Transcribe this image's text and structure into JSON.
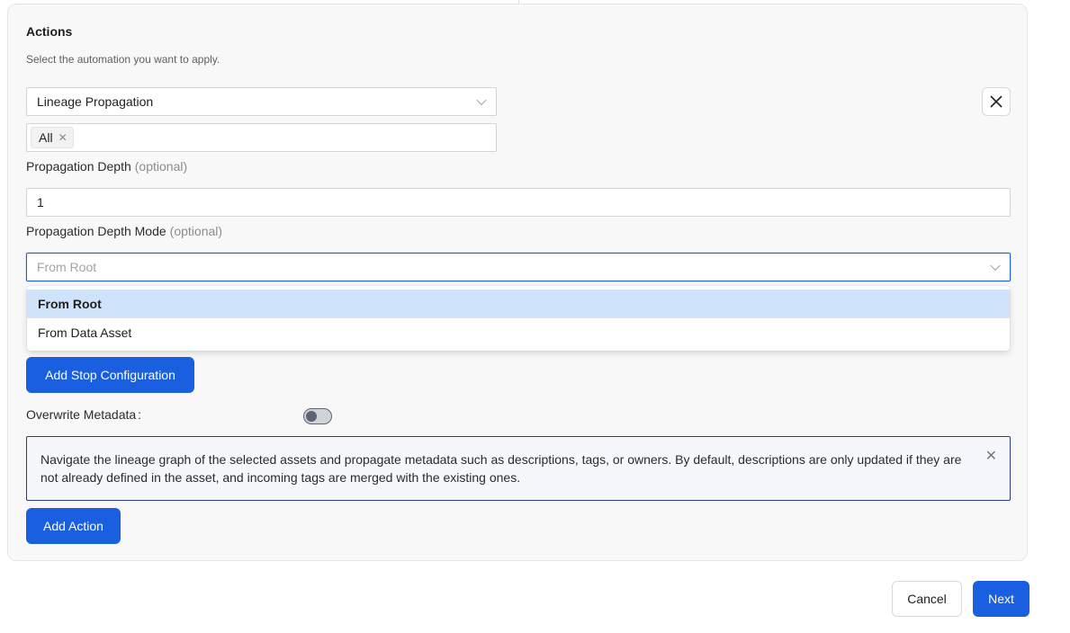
{
  "actions": {
    "title": "Actions",
    "subtitle": "Select the automation you want to apply.",
    "action_select_value": "Lineage Propagation",
    "tags": [
      {
        "label": "All"
      }
    ],
    "propagation_depth": {
      "label": "Propagation Depth",
      "optional": "(optional)",
      "value": "1"
    },
    "propagation_depth_mode": {
      "label": "Propagation Depth Mode",
      "optional": "(optional)",
      "placeholder": "From Root",
      "options": [
        {
          "label": "From Root",
          "selected": true
        },
        {
          "label": "From Data Asset",
          "selected": false
        }
      ]
    },
    "add_stop_configuration_label": "Add Stop Configuration",
    "overwrite_metadata": {
      "label": "Overwrite Metadata",
      "enabled": false
    },
    "info_text": "Navigate the lineage graph of the selected assets and propagate metadata such as descriptions, tags, or owners. By default, descriptions are only updated if they are not already defined in the asset, and incoming tags are merged with the existing ones.",
    "add_action_label": "Add Action"
  },
  "footer": {
    "cancel_label": "Cancel",
    "next_label": "Next"
  },
  "colors": {
    "primary": "#1a5fe0",
    "selected_option": "#cfe4fb",
    "info_border": "#2c3e7a"
  }
}
